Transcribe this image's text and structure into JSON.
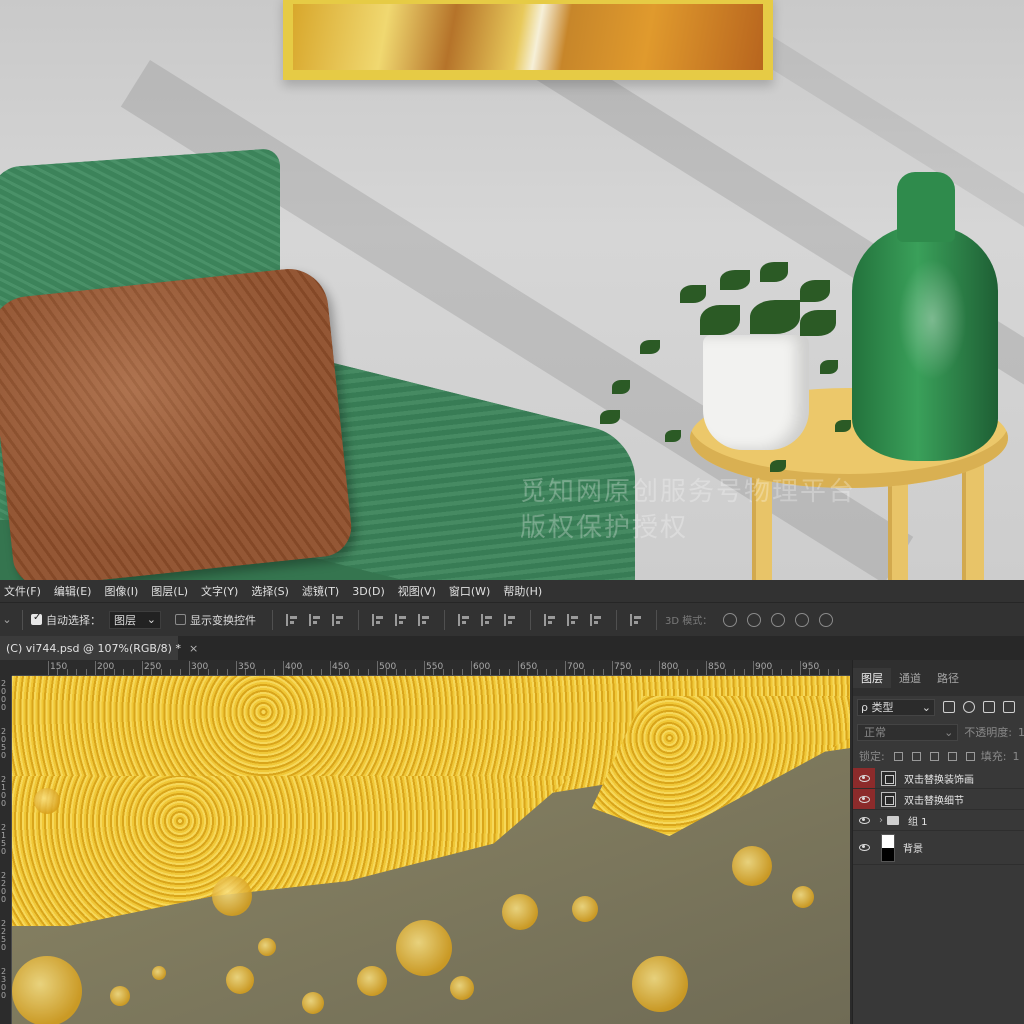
{
  "menu": [
    "文件(F)",
    "编辑(E)",
    "图像(I)",
    "图层(L)",
    "文字(Y)",
    "选择(S)",
    "滤镜(T)",
    "3D(D)",
    "视图(V)",
    "窗口(W)",
    "帮助(H)"
  ],
  "options": {
    "auto_select_label": "自动选择：",
    "auto_select_checked": true,
    "auto_select_value": "图层",
    "show_transform_label": "显示变换控件",
    "show_transform_checked": false,
    "mode_label": "3D 模式："
  },
  "document_tab": {
    "title": "(C) vi744.psd @ 107%(RGB/8) *",
    "close": "×"
  },
  "ruler": {
    "h_ticks": [
      "150",
      "200",
      "250",
      "300",
      "350",
      "400",
      "450",
      "500",
      "550",
      "600",
      "650",
      "700",
      "750",
      "800",
      "850",
      "900",
      "950"
    ],
    "v_ticks": [
      "2000",
      "2050",
      "2100",
      "2150",
      "2200",
      "2250",
      "2300"
    ]
  },
  "watermark": {
    "line1": "觅知网原创服务号物理平台",
    "line2": "版权保护授权"
  },
  "layers_panel": {
    "tabs": [
      "图层",
      "通道",
      "路径"
    ],
    "filter_label": "ρ 类型",
    "blend_mode": "正常",
    "opacity_label": "不透明度:",
    "opacity_value": "1",
    "lock_label": "锁定:",
    "fill_label": "填充:",
    "fill_value": "1",
    "layers": [
      {
        "name": "双击替换装饰画",
        "type": "smart",
        "highlight": true
      },
      {
        "name": "双击替换细节",
        "type": "smart",
        "highlight": true
      },
      {
        "name": "组 1",
        "type": "group",
        "highlight": false
      },
      {
        "name": "背景",
        "type": "background",
        "highlight": false
      }
    ]
  },
  "colors": {
    "ui_bg": "#323232",
    "panel_bg": "#383838",
    "eye_highlight": "#8c2b2b",
    "gold": "#e3b522"
  }
}
